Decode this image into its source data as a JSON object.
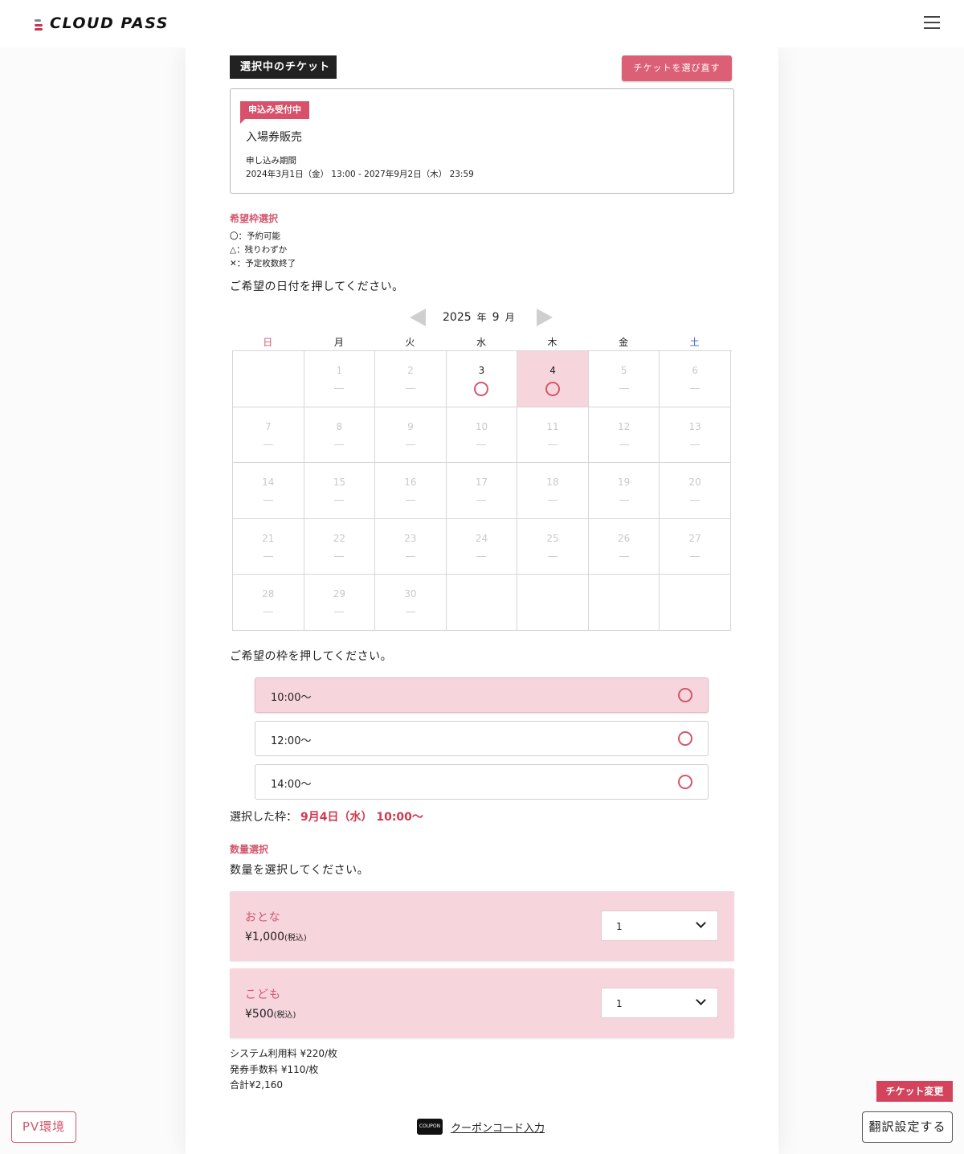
{
  "header": {
    "logo_text": "CLOUD PASS",
    "menu_icon": "hamburger-menu-icon"
  },
  "ticket": {
    "section_label": "選択中のチケット",
    "reselect_button": "チケットを選び直す",
    "status_badge": "申込み受付中",
    "name": "入場券販売",
    "period_label": "申し込み期間",
    "period_value": "2024年3月1日（金） 13:00 - 2027年9月2日（木） 23:59"
  },
  "slot_select": {
    "title": "希望枠選択",
    "legend": [
      "〇：予約可能",
      "△：残りわずか",
      "✕：予定枚数終了"
    ],
    "date_instruction": "ご希望の日付を押してください。",
    "frame_instruction": "ご希望の枠を押してください。"
  },
  "calendar": {
    "year": "2025",
    "year_unit": "年",
    "month": "9",
    "month_unit": "月",
    "weekdays": [
      "日",
      "月",
      "火",
      "水",
      "木",
      "金",
      "土"
    ],
    "days": [
      {
        "day": "",
        "status": "blank"
      },
      {
        "day": "1",
        "status": "none"
      },
      {
        "day": "2",
        "status": "none"
      },
      {
        "day": "3",
        "status": "available"
      },
      {
        "day": "4",
        "status": "available",
        "selected": true
      },
      {
        "day": "5",
        "status": "none"
      },
      {
        "day": "6",
        "status": "none"
      },
      {
        "day": "7",
        "status": "none"
      },
      {
        "day": "8",
        "status": "none"
      },
      {
        "day": "9",
        "status": "none"
      },
      {
        "day": "10",
        "status": "none"
      },
      {
        "day": "11",
        "status": "none"
      },
      {
        "day": "12",
        "status": "none"
      },
      {
        "day": "13",
        "status": "none"
      },
      {
        "day": "14",
        "status": "none"
      },
      {
        "day": "15",
        "status": "none"
      },
      {
        "day": "16",
        "status": "none"
      },
      {
        "day": "17",
        "status": "none"
      },
      {
        "day": "18",
        "status": "none"
      },
      {
        "day": "19",
        "status": "none"
      },
      {
        "day": "20",
        "status": "none"
      },
      {
        "day": "21",
        "status": "none"
      },
      {
        "day": "22",
        "status": "none"
      },
      {
        "day": "23",
        "status": "none"
      },
      {
        "day": "24",
        "status": "none"
      },
      {
        "day": "25",
        "status": "none"
      },
      {
        "day": "26",
        "status": "none"
      },
      {
        "day": "27",
        "status": "none"
      },
      {
        "day": "28",
        "status": "none"
      },
      {
        "day": "29",
        "status": "none"
      },
      {
        "day": "30",
        "status": "none"
      },
      {
        "day": "",
        "status": "blank"
      },
      {
        "day": "",
        "status": "blank"
      },
      {
        "day": "",
        "status": "blank"
      },
      {
        "day": "",
        "status": "blank"
      }
    ]
  },
  "time_slots": [
    {
      "time": "10:00〜",
      "selected": true
    },
    {
      "time": "12:00〜",
      "selected": false
    },
    {
      "time": "14:00〜",
      "selected": false
    }
  ],
  "selection": {
    "label": "選択した枠：",
    "value": "9月4日（水） 10:00〜"
  },
  "quantity": {
    "title": "数量選択",
    "instruction": "数量を選択してください。",
    "items": [
      {
        "name": "おとな",
        "price": "¥1,000",
        "tax_note": "(税込)",
        "quantity": "1"
      },
      {
        "name": "こども",
        "price": "¥500",
        "tax_note": "(税込)",
        "quantity": "1"
      }
    ]
  },
  "fees": {
    "system_fee": "システム利用料 ¥220/枚",
    "issue_fee": "発券手数料 ¥110/枚",
    "total": "合計¥2,160"
  },
  "coupon": {
    "icon_text": "COUPON",
    "link_text": "クーポンコード入力"
  },
  "floating": {
    "pv_button": "PV環境",
    "ticket_change": "チケット変更",
    "translate_button": "翻訳設定する"
  },
  "colors": {
    "accent": "#d3576d",
    "selected_bg": "#f6d5dd",
    "saturday": "#3d62c8"
  }
}
